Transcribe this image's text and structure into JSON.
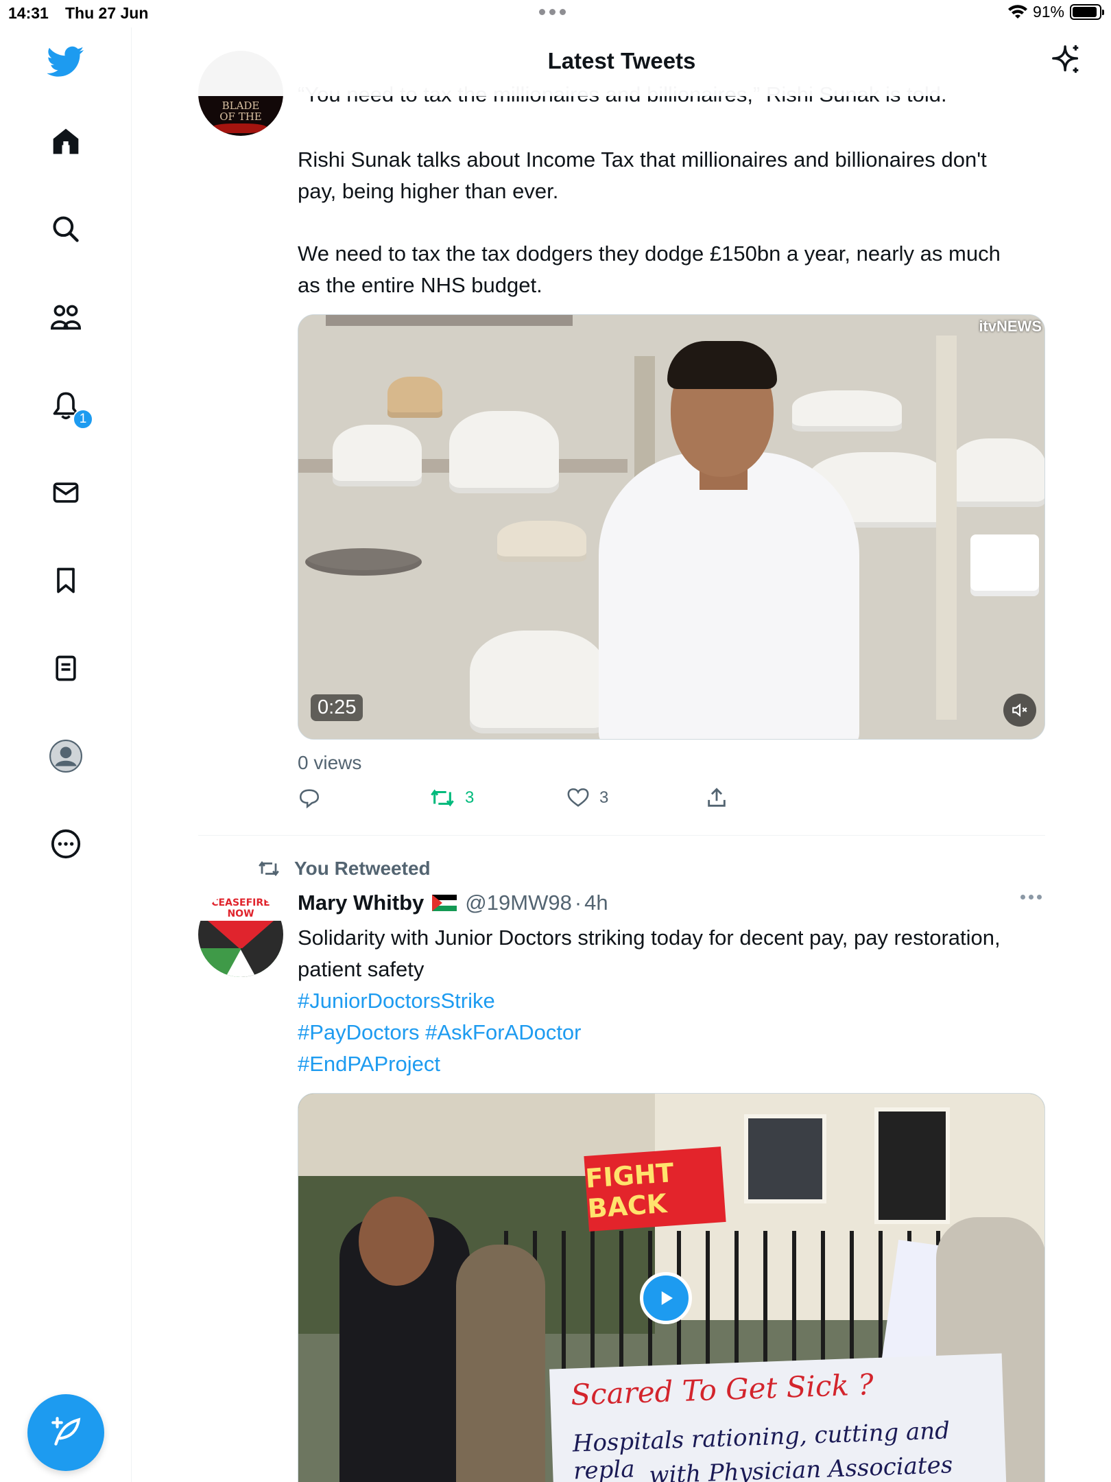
{
  "status_bar": {
    "time": "14:31",
    "date": "Thu 27 Jun",
    "battery": "91%",
    "battery_level": 0.91
  },
  "header": {
    "title": "Latest Tweets"
  },
  "sidebar": {
    "items": [
      {
        "icon": "home-icon"
      },
      {
        "icon": "search-icon"
      },
      {
        "icon": "communities-icon"
      },
      {
        "icon": "notifications-icon",
        "badge": "1"
      },
      {
        "icon": "messages-icon"
      },
      {
        "icon": "bookmarks-icon"
      },
      {
        "icon": "lists-icon"
      },
      {
        "icon": "profile-icon"
      },
      {
        "icon": "more-icon"
      }
    ]
  },
  "tweet1": {
    "avatar_text_1": "BLADE",
    "avatar_text_2": "OF THE",
    "quote_line": "“You need to tax the millionaires and billionaires,” Rishi Sunak is told.",
    "para1": "Rishi Sunak talks about Income Tax that millionaires and billionaires don't pay, being higher than ever.",
    "para2": "We need to tax the tax dodgers they dodge £150bn a year, nearly as much as the entire NHS budget.",
    "media": {
      "channel": "itvNEWS",
      "duration": "0:25"
    },
    "views": "0 views",
    "retweets": "3",
    "likes": "3",
    "retweeted_color": "#00ba7c"
  },
  "tweet2": {
    "retweet_label": "You Retweeted",
    "name": "Mary Whitby",
    "flag": "🇵🇸",
    "handle": "@19MW98",
    "separator": "·",
    "time": "4h",
    "avatar_text": "CEASEFIRE NOW",
    "text": "Solidarity with Junior Doctors striking today for decent pay, pay restoration, patient safety",
    "hashtags": [
      "#JuniorDoctorsStrike",
      "#PayDoctors",
      "#AskForADoctor",
      "#EndPAProject"
    ],
    "media": {
      "sign1": "FIGHT BACK",
      "banner_line1": "Scared To Get Sick ?",
      "banner_line2": "Hospitals rationing, cutting and repla",
      "banner_line3": "with Physician Associates"
    }
  },
  "colors": {
    "accent": "#1d9bf0",
    "text": "#0f1419",
    "muted": "#536471"
  }
}
